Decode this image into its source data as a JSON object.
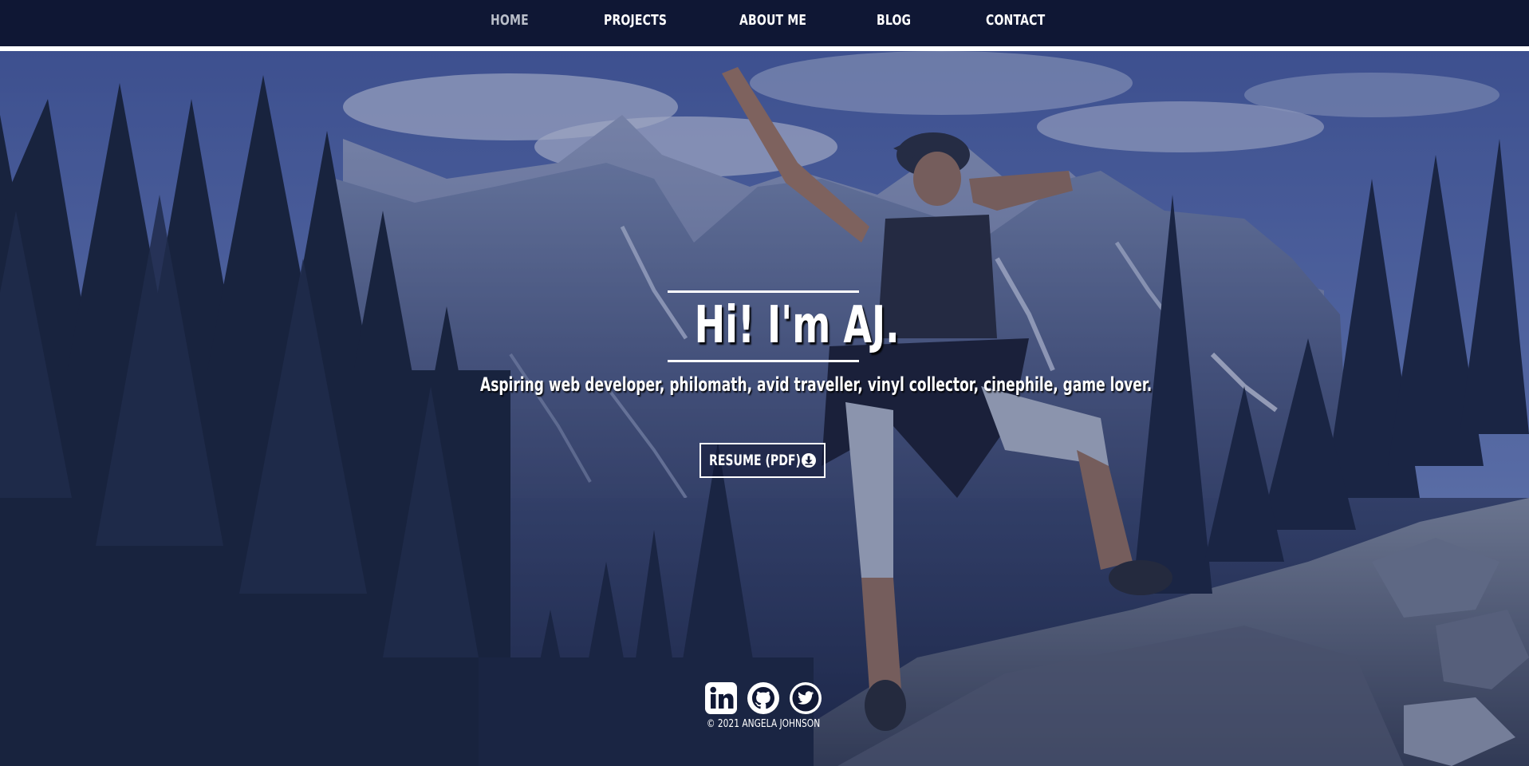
{
  "nav": {
    "items": [
      {
        "label": "HOME",
        "active": true
      },
      {
        "label": "PROJECTS",
        "active": false
      },
      {
        "label": "ABOUT ME",
        "active": false
      },
      {
        "label": "BLOG",
        "active": false
      },
      {
        "label": "CONTACT",
        "active": false
      }
    ]
  },
  "hero": {
    "title": "Hi! I'm AJ.",
    "tagline": "Aspiring web developer, philomath, avid traveller, vinyl collector, cinephile, game lover.",
    "resume_button": {
      "label": "RESUME (PDF)",
      "icon": "download-icon"
    }
  },
  "social": {
    "icons": [
      "linkedin-icon",
      "github-icon",
      "twitter-icon"
    ]
  },
  "footer": {
    "copyright": "© 2021 ANGELA JOHNSON"
  },
  "colors": {
    "nav_background": "#0f1734",
    "nav_active": "#b9bec9",
    "text": "#ffffff",
    "overlay": "#162050"
  }
}
